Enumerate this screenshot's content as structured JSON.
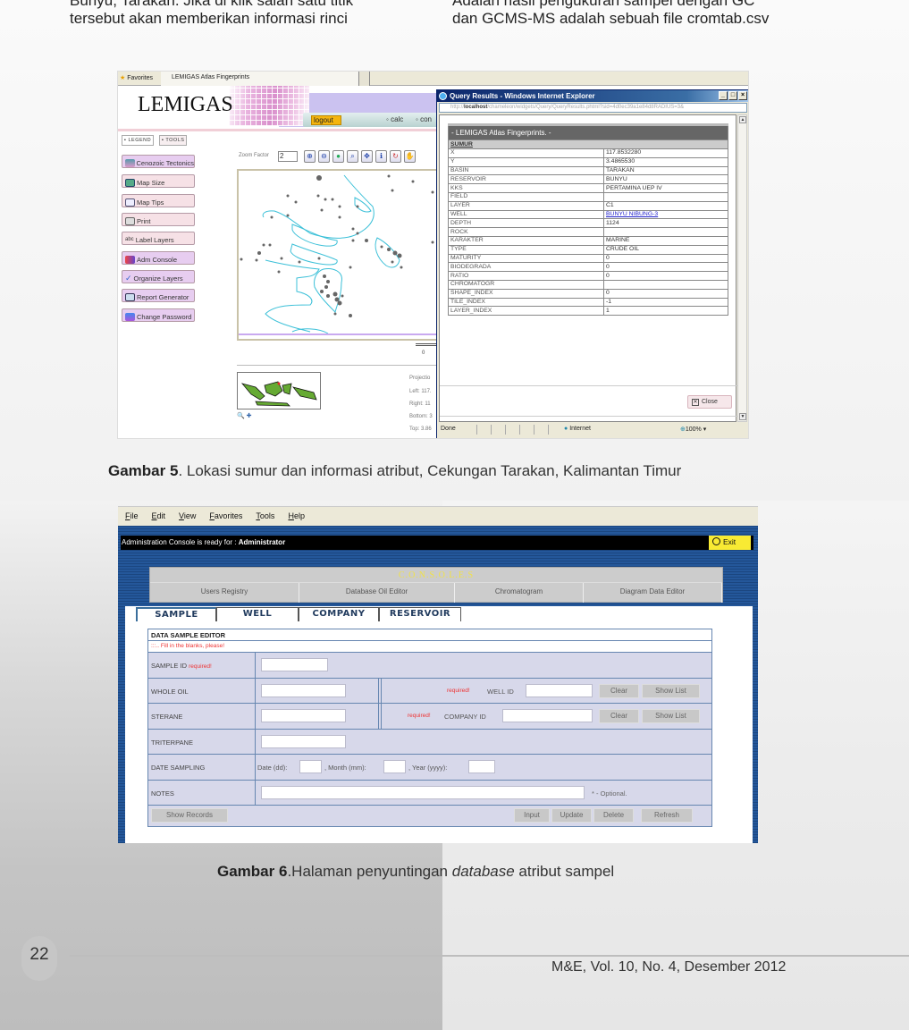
{
  "page": {
    "body_text_left": [
      "Bunyu, Tarakan. Jika di klik salah satu titik",
      "tersebut akan memberikan informasi rinci"
    ],
    "body_text_right": [
      "Adalah hasil pengukuran sampel dengan GC",
      "dan GCMS-MS adalah sebuah file cromtab.csv"
    ],
    "page_number": "22",
    "journal_ref": "M&E, Vol. 10, No. 4,  Desember 2012"
  },
  "figure5": {
    "caption_label": "Gambar 5",
    "caption_text": ". Lokasi sumur dan informasi atribut, Cekungan Tarakan, Kalimantan Timur",
    "browser": {
      "favorites_label": "Favorites",
      "tab_title": "LEMIGAS Atlas Fingerprints"
    },
    "app": {
      "logo": "LEMIGAS",
      "nav": {
        "logout": "logout",
        "calc": "calc",
        "con": "con"
      },
      "panel_tabs": [
        "LEGEND",
        "TOOLS"
      ],
      "tools": [
        {
          "label": "Cenozoic Tectonics",
          "icon": "globe-icon"
        },
        {
          "label": "Map Size",
          "icon": "map-size-icon"
        },
        {
          "label": "Map Tips",
          "icon": "speech-bubble-icon"
        },
        {
          "label": "Print",
          "icon": "printer-icon"
        },
        {
          "label": "Label Layers",
          "icon": "label-icon"
        },
        {
          "label": "Adm Console",
          "icon": "admin-icon"
        },
        {
          "label": "Organize Layers",
          "icon": "checkmark-icon"
        },
        {
          "label": "Report Generator",
          "icon": "report-icon"
        },
        {
          "label": "Change Password",
          "icon": "users-icon"
        }
      ],
      "zoom_factor_label": "Zoom Factor",
      "zoom_factor_value": "2",
      "map_tools": [
        "zoom-in-icon",
        "zoom-out-icon",
        "full-extent-icon",
        "zoom-box-icon",
        "pan-icon",
        "identify-icon",
        "refresh-icon",
        "hand-icon"
      ],
      "scale_label": "0",
      "overview_icons": "🔍 ✚",
      "extent": {
        "projection": "Projectio",
        "left": "Left: 117.",
        "right": "Right: 11",
        "bottom": "Bottom: 3",
        "top": "Top: 3.86"
      }
    },
    "popup": {
      "title": "Query Results - Windows Internet Explorer",
      "address_prefix": "http://",
      "address_host": "localhost",
      "address_path": "/chameleon/widgets/Query/QueryResults.phtml?sid=4d0ec39a1e84d8RADIUS=3&",
      "table_title": "- LEMIGAS Atlas Fingerprints. -",
      "layer_name": "SUMUR",
      "rows": [
        {
          "field": "X",
          "value": "117.8532280"
        },
        {
          "field": "Y",
          "value": "3.4865530"
        },
        {
          "field": "BASIN",
          "value": "TARAKAN"
        },
        {
          "field": "RESERVOIR",
          "value": "BUNYU"
        },
        {
          "field": "KKS",
          "value": "PERTAMINA UEP IV"
        },
        {
          "field": "FIELD",
          "value": ""
        },
        {
          "field": "LAYER",
          "value": "C1"
        },
        {
          "field": "WELL",
          "value": "BUNYU NIBUNG-3",
          "link": true
        },
        {
          "field": "DEPTH",
          "value": "1124"
        },
        {
          "field": "ROCK",
          "value": ""
        },
        {
          "field": "KARAKTER",
          "value": "MARINE"
        },
        {
          "field": "TYPE",
          "value": "CRUDE OIL"
        },
        {
          "field": "MATURITY",
          "value": "0"
        },
        {
          "field": "BIODEGRADA",
          "value": "0"
        },
        {
          "field": "RATIO",
          "value": "0"
        },
        {
          "field": "CHROMATOGR",
          "value": ""
        },
        {
          "field": "SHAPE_INDEX",
          "value": "0"
        },
        {
          "field": "TILE_INDEX",
          "value": "-1"
        },
        {
          "field": "LAYER_INDEX",
          "value": "1"
        }
      ],
      "close_label": "Close",
      "status": {
        "left": "Done",
        "zone": "Internet",
        "zoom": "100%"
      }
    }
  },
  "figure6": {
    "caption_label": "Gambar 6",
    "caption_text": ".Halaman penyuntingan ",
    "caption_italic": "database",
    "caption_end": " atribut sampel",
    "menu": [
      "File",
      "Edit",
      "View",
      "Favorites",
      "Tools",
      "Help"
    ],
    "status_prefix": "Administration Console is ready for : ",
    "status_user": "Administrator",
    "exit_label": "Exit",
    "consoles_title": "C.O.N.S.O.L.E.S",
    "consoles_nav": [
      "Users Registry",
      "Database Oil Editor",
      "Chromatogram",
      "Diagram Data Editor"
    ],
    "tabs": [
      "SAMPLE",
      "WELL",
      "COMPANY",
      "RESERVOIR"
    ],
    "form": {
      "title": "DATA SAMPLE EDITOR",
      "hint": ":::.. Fill in the blanks, please!",
      "sample_id": "SAMPLE ID",
      "required": "required!",
      "whole_oil": "WHOLE OIL",
      "well_id": "WELL ID",
      "sterane": "STERANE",
      "company_id": "COMPANY ID",
      "triterpane": "TRITERPANE",
      "date_sampling": "DATE SAMPLING",
      "date_dd": "Date (dd):",
      "month_mm": ", Month (mm):",
      "year_yyyy": ", Year (yyyy):",
      "notes": "NOTES",
      "optional": "* - Optional.",
      "clear": "Clear",
      "show_list": "Show List",
      "show_records": "Show Records",
      "input": "Input",
      "update": "Update",
      "delete": "Delete",
      "refresh": "Refresh"
    }
  }
}
